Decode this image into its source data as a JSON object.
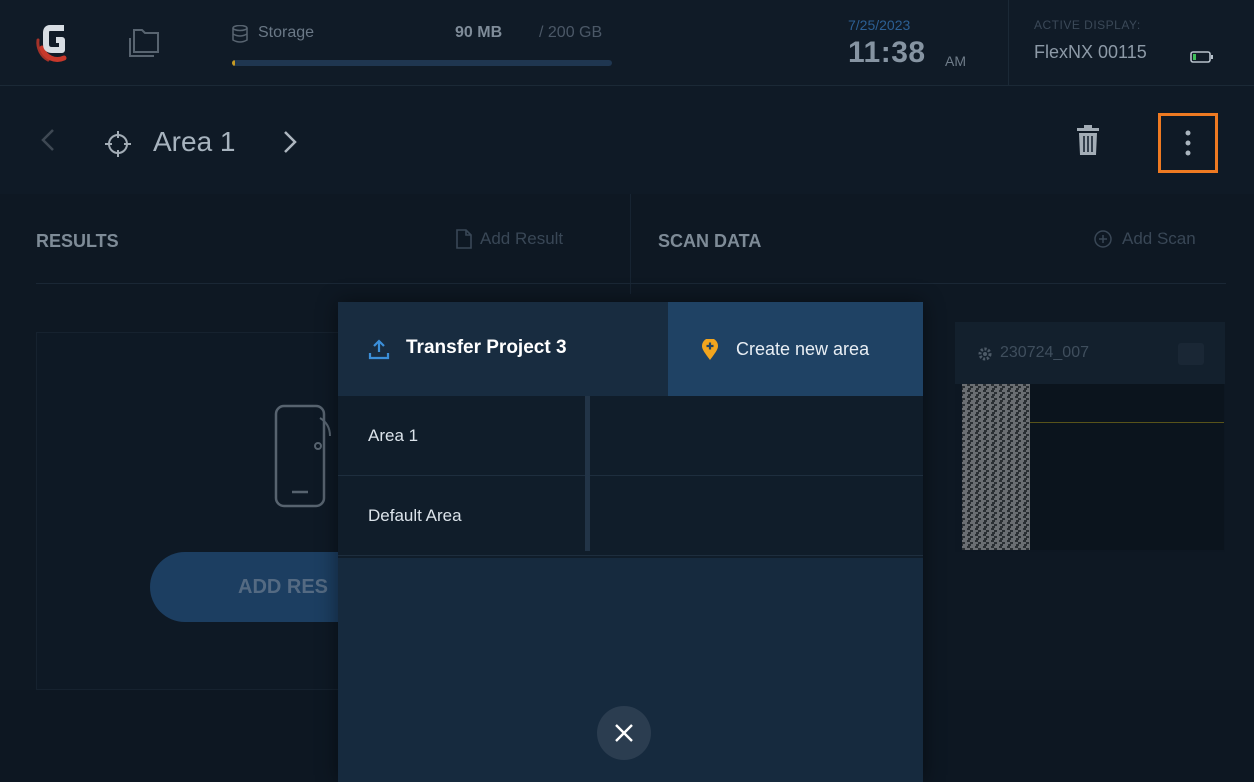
{
  "status_bar": {
    "storage_label": "Storage",
    "storage_used": "90 MB",
    "storage_total": "/ 200 GB",
    "storage_fraction": 0.0005,
    "date": "7/25/2023",
    "time": "11:38",
    "ampm": "AM",
    "active_display_label": "ACTIVE DISPLAY:",
    "active_display_device": "FlexNX 00115"
  },
  "area_header": {
    "title": "Area 1"
  },
  "results_panel": {
    "heading": "RESULTS",
    "add_result_label": "Add Result",
    "add_results_button": "ADD RES"
  },
  "scan_panel": {
    "heading": "SCAN DATA",
    "add_scan_label": "Add Scan",
    "scan_name": "230724_007"
  },
  "dialog": {
    "transfer_label": "Transfer Project 3",
    "create_area_label": "Create new area",
    "areas": [
      {
        "label": "Area 1"
      },
      {
        "label": "Default Area"
      }
    ]
  },
  "colors": {
    "accent_orange": "#ee7a22",
    "pin_yellow": "#f2a51e",
    "dialog_blue": "#1f4264"
  }
}
